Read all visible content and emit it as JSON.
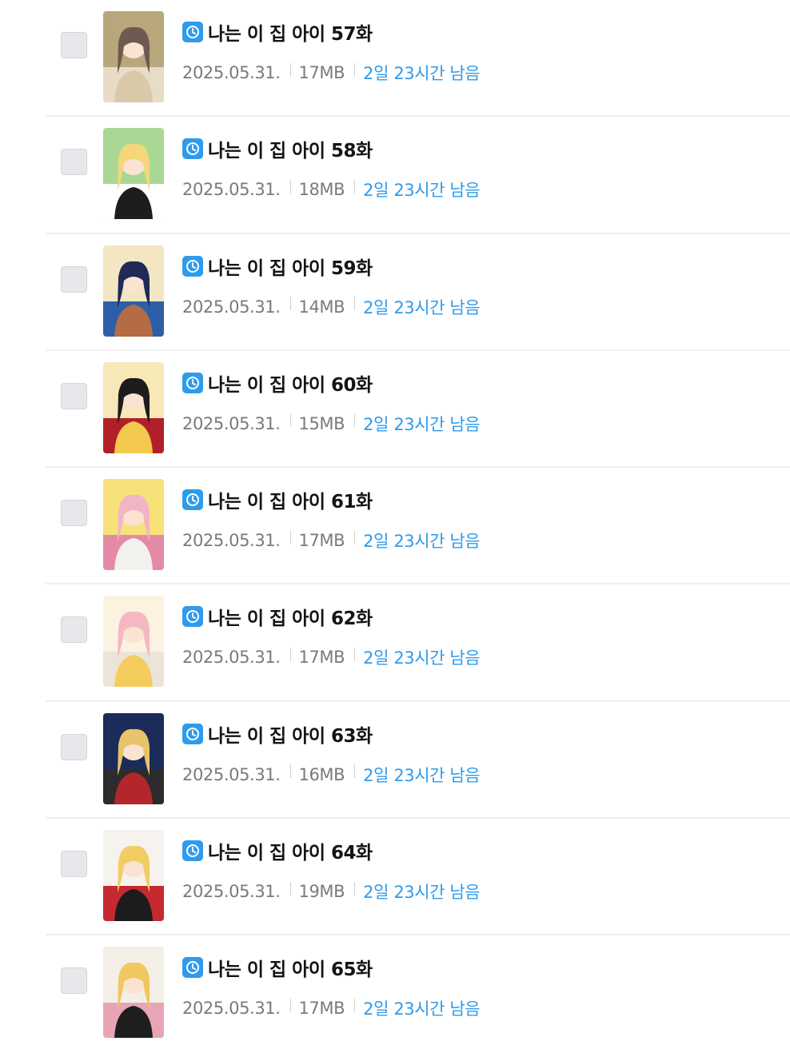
{
  "accent_color": "#2e9bec",
  "status_icon": "clock-icon",
  "episodes": [
    {
      "title": "나는 이 집 아이 57화",
      "date": "2025.05.31.",
      "size": "17MB",
      "remaining": "2일 23시간 남음",
      "palette": [
        "#b9a77c",
        "#d9c9a8",
        "#6e5a52",
        "#e8dcc7"
      ]
    },
    {
      "title": "나는 이 집 아이 58화",
      "date": "2025.05.31.",
      "size": "18MB",
      "remaining": "2일 23시간 남음",
      "palette": [
        "#a9d894",
        "#1d1d1d",
        "#f3d77a",
        "#ffffff"
      ]
    },
    {
      "title": "나는 이 집 아이 59화",
      "date": "2025.05.31.",
      "size": "14MB",
      "remaining": "2일 23시간 남음",
      "palette": [
        "#f3e6c3",
        "#b56b43",
        "#1f2a55",
        "#2c5fa8"
      ]
    },
    {
      "title": "나는 이 집 아이 60화",
      "date": "2025.05.31.",
      "size": "15MB",
      "remaining": "2일 23시간 남음",
      "palette": [
        "#f7e8b8",
        "#f2c94c",
        "#1c1c1c",
        "#b1202a"
      ]
    },
    {
      "title": "나는 이 집 아이 61화",
      "date": "2025.05.31.",
      "size": "17MB",
      "remaining": "2일 23시간 남음",
      "palette": [
        "#f7e27a",
        "#f3f1ee",
        "#f1b5c6",
        "#e58aa6"
      ]
    },
    {
      "title": "나는 이 집 아이 62화",
      "date": "2025.05.31.",
      "size": "17MB",
      "remaining": "2일 23시간 남음",
      "palette": [
        "#fbf3e0",
        "#f4cc5d",
        "#f4b8c3",
        "#ece4d8"
      ]
    },
    {
      "title": "나는 이 집 아이 63화",
      "date": "2025.05.31.",
      "size": "16MB",
      "remaining": "2일 23시간 남음",
      "palette": [
        "#1b2c5a",
        "#b3262b",
        "#e7c36b",
        "#2c2c2c"
      ]
    },
    {
      "title": "나는 이 집 아이 64화",
      "date": "2025.05.31.",
      "size": "19MB",
      "remaining": "2일 23시간 남음",
      "palette": [
        "#f6f3ef",
        "#1c1c1c",
        "#f2cd64",
        "#c42a2f"
      ]
    },
    {
      "title": "나는 이 집 아이 65화",
      "date": "2025.05.31.",
      "size": "17MB",
      "remaining": "2일 23시간 남음",
      "palette": [
        "#f4efe6",
        "#1e1e1e",
        "#f0c760",
        "#e7a5b5"
      ]
    }
  ]
}
